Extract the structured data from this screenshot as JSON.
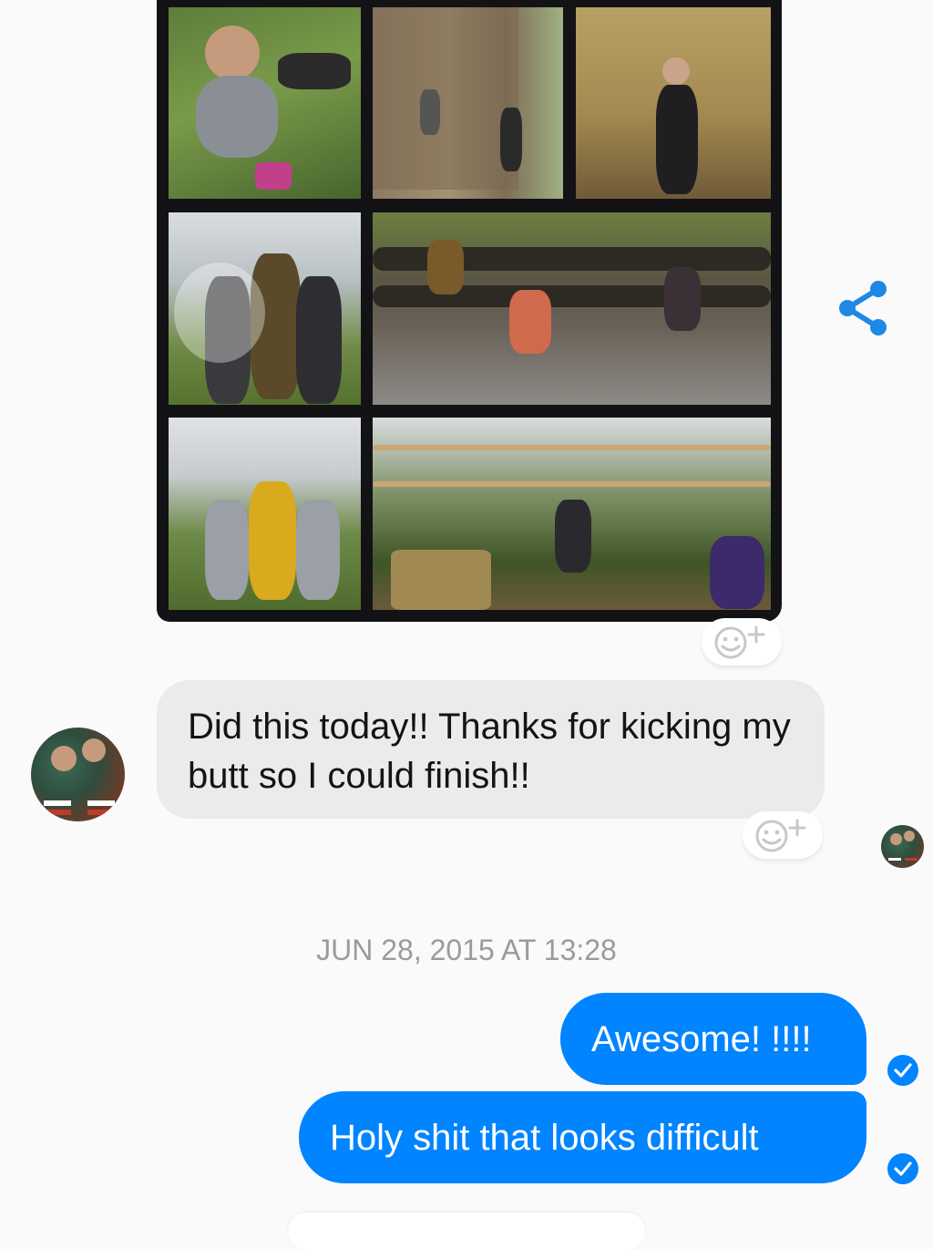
{
  "thread": {
    "shared_photo": {
      "description_icon": "photo-collage-icon"
    },
    "incoming_message": {
      "text": "Did this today!! Thanks for kicking my butt so I could finish!!"
    },
    "timestamp": "JUN 28, 2015 AT 13:28",
    "outgoing_messages": [
      {
        "text": "Awesome! !!!!"
      },
      {
        "text": "Holy shit that looks difficult"
      }
    ]
  },
  "icons": {
    "share": "share-icon",
    "reaction": "add-reaction-icon",
    "seen": "check-circle-icon"
  },
  "colors": {
    "accent": "#0084ff",
    "incoming_bubble": "#ebebeb",
    "timestamp": "#9b9b9b",
    "background": "#fafafa"
  }
}
